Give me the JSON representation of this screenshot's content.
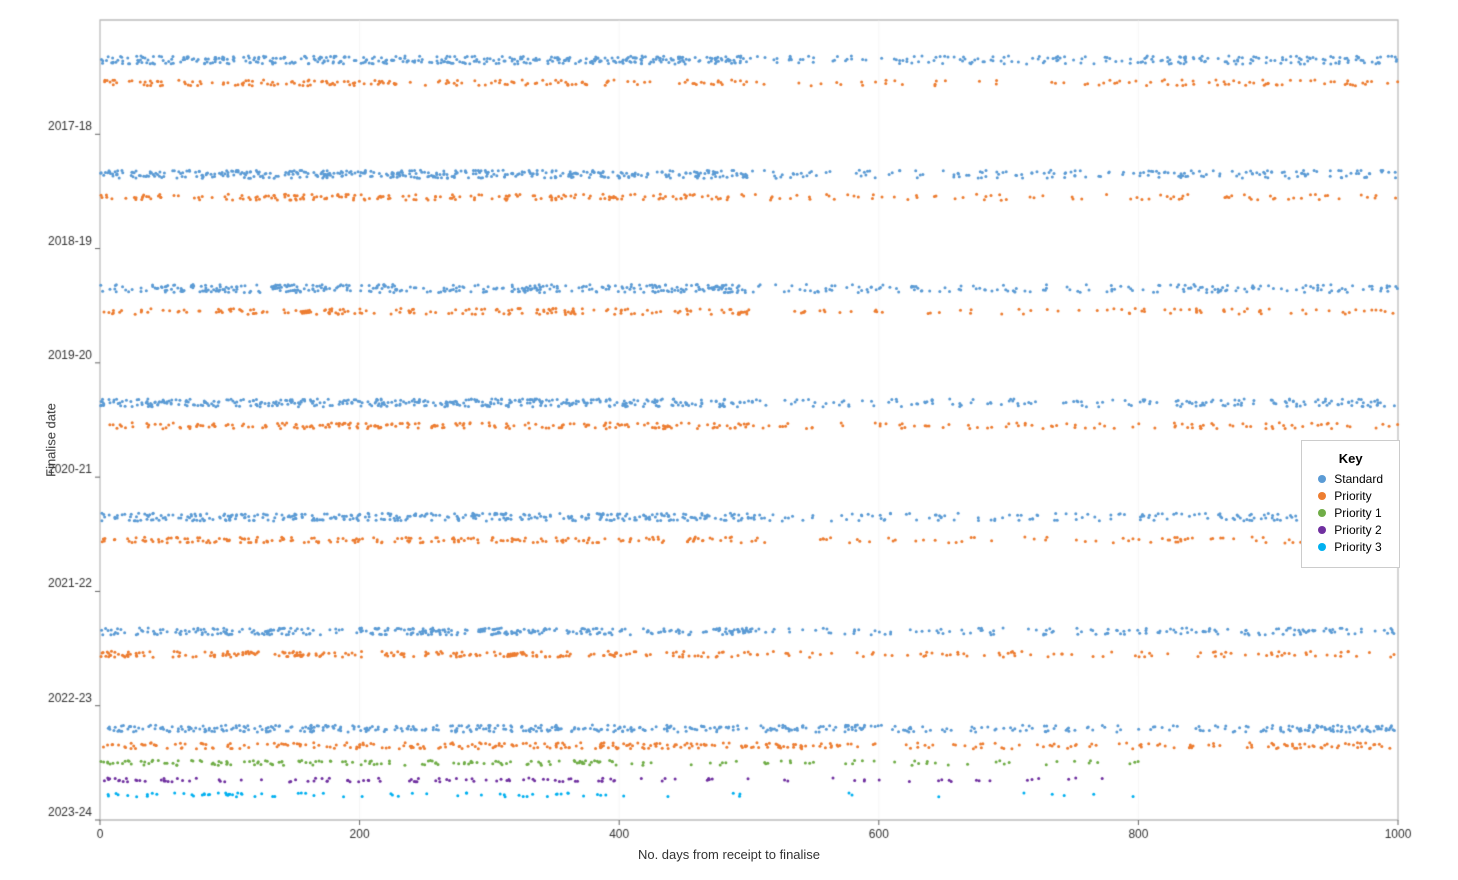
{
  "chart": {
    "title": "",
    "y_axis_label": "Finalise date",
    "x_axis_label": "No. days from receipt to finalise",
    "x_min": 0,
    "x_max": 1000,
    "y_categories": [
      "2017-18",
      "2018-19",
      "2019-20",
      "2020-21",
      "2021-22",
      "2022-23",
      "2023-24"
    ],
    "x_ticks": [
      0,
      200,
      400,
      600,
      800,
      1000
    ]
  },
  "legend": {
    "title": "Key",
    "items": [
      {
        "label": "Standard",
        "color": "#5b9bd5"
      },
      {
        "label": "Priority",
        "color": "#ed7d31"
      },
      {
        "label": "Priority 1",
        "color": "#70ad47"
      },
      {
        "label": "Priority 2",
        "color": "#7030a0"
      },
      {
        "label": "Priority 3",
        "color": "#00b0f0"
      }
    ]
  }
}
